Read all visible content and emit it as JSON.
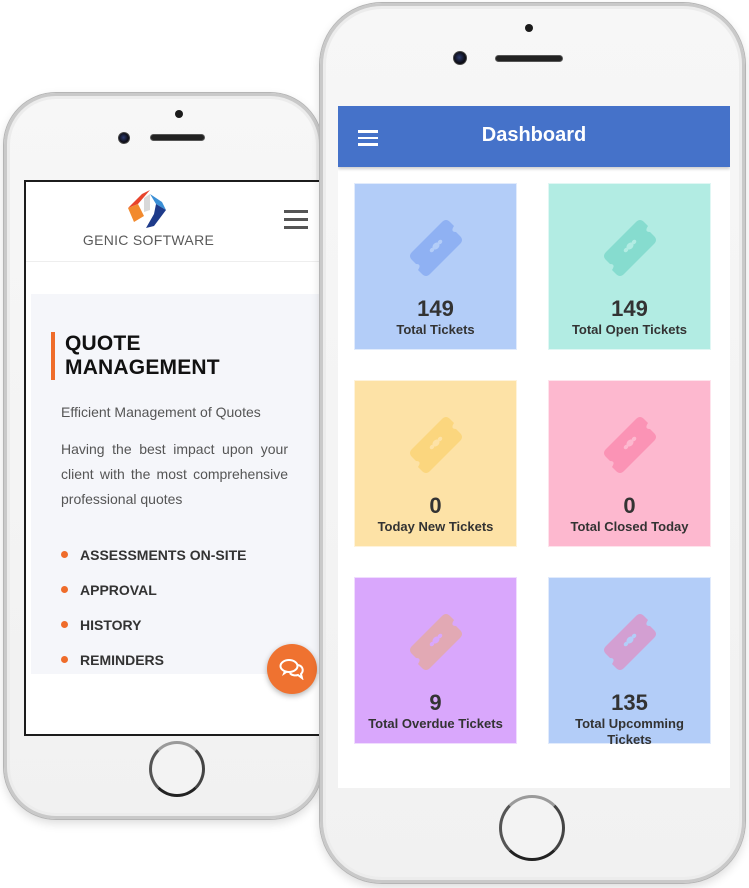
{
  "left_phone": {
    "brand": {
      "name": "GENIC SOFTWARE",
      "logo_colors": [
        "#e8442c",
        "#f28a2e",
        "#d9d9d9",
        "#1e3b8a",
        "#3a8fd6"
      ]
    },
    "menu_icon": "hamburger-icon",
    "section": {
      "title_line1": "QUOTE",
      "title_line2": "MANAGEMENT",
      "subtitle": "Efficient Management of Quotes",
      "description": "Having the best impact upon your client with the most comprehensive professional quotes",
      "features": [
        "ASSESSMENTS ON-SITE",
        "APPROVAL",
        "HISTORY",
        "REMINDERS"
      ]
    },
    "chat_button_icon": "chat-bubbles-icon",
    "accent_color": "#ef6c2a"
  },
  "right_phone": {
    "app_bar": {
      "title": "Dashboard",
      "menu_icon": "hamburger-icon",
      "color": "#4572c9"
    },
    "tiles": [
      {
        "value": "149",
        "label": "Total Tickets",
        "bg": "#b3cdf8",
        "icon_color": "#8fb1f3",
        "icon": "ticket-icon"
      },
      {
        "value": "149",
        "label": "Total Open Tickets",
        "bg": "#b2ece3",
        "icon_color": "#86dccf",
        "icon": "ticket-icon"
      },
      {
        "value": "0",
        "label": "Today New Tickets",
        "bg": "#fde2a6",
        "icon_color": "#fbd67e",
        "icon": "ticket-icon"
      },
      {
        "value": "0",
        "label": "Total Closed Today",
        "bg": "#fdb8cf",
        "icon_color": "#fb93b5",
        "icon": "ticket-icon"
      },
      {
        "value": "9",
        "label": "Total Overdue Tickets",
        "bg": "#d9a7fc",
        "icon_color": "#e2a9b4",
        "icon": "ticket-icon"
      },
      {
        "value": "135",
        "label": "Total Upcomming Tickets",
        "bg": "#b3cdf8",
        "icon_color": "#d39fd2",
        "icon": "ticket-icon"
      }
    ]
  }
}
